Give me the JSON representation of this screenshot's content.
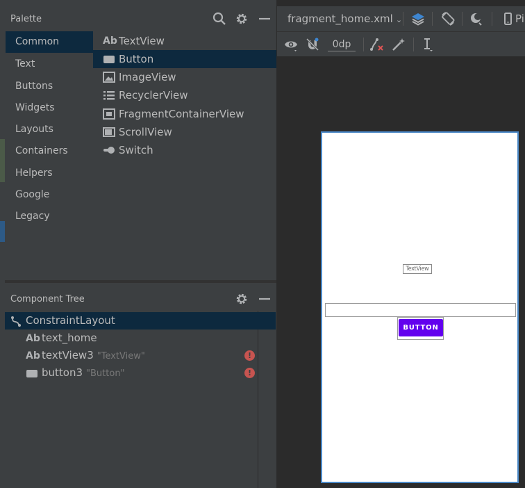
{
  "palette": {
    "title": "Palette",
    "categories": [
      "Common",
      "Text",
      "Buttons",
      "Widgets",
      "Layouts",
      "Containers",
      "Helpers",
      "Google",
      "Legacy"
    ],
    "active_category": "Common",
    "widgets": [
      {
        "label": "TextView",
        "icon": "text-ab-icon"
      },
      {
        "label": "Button",
        "icon": "button-icon"
      },
      {
        "label": "ImageView",
        "icon": "image-icon"
      },
      {
        "label": "RecyclerView",
        "icon": "list-icon"
      },
      {
        "label": "FragmentContainerView",
        "icon": "fragment-icon"
      },
      {
        "label": "ScrollView",
        "icon": "scroll-icon"
      },
      {
        "label": "Switch",
        "icon": "switch-icon"
      }
    ],
    "selected_widget": "Button"
  },
  "component_tree": {
    "title": "Component Tree",
    "root": {
      "label": "ConstraintLayout",
      "icon": "constraint-layout-icon"
    },
    "children": [
      {
        "label": "text_home",
        "sub": "",
        "icon": "text-ab-icon",
        "error": false
      },
      {
        "label": "textView3",
        "sub": "\"TextView\"",
        "icon": "text-ab-icon",
        "error": true
      },
      {
        "label": "button3",
        "sub": "\"Button\"",
        "icon": "button-icon",
        "error": true
      }
    ]
  },
  "editor": {
    "file_name": "fragment_home.xml",
    "device_label": "Pi",
    "default_margin": "0dp"
  },
  "design_preview": {
    "textview_label": "TextView",
    "button_label": "BUTTON"
  },
  "colors": {
    "panel_bg": "#3c3f41",
    "editor_bg": "#2b2b2b",
    "selection": "#0d293e",
    "accent_blue": "#4a88c7",
    "button_purple": "#6200ee",
    "error_red": "#c75450"
  }
}
